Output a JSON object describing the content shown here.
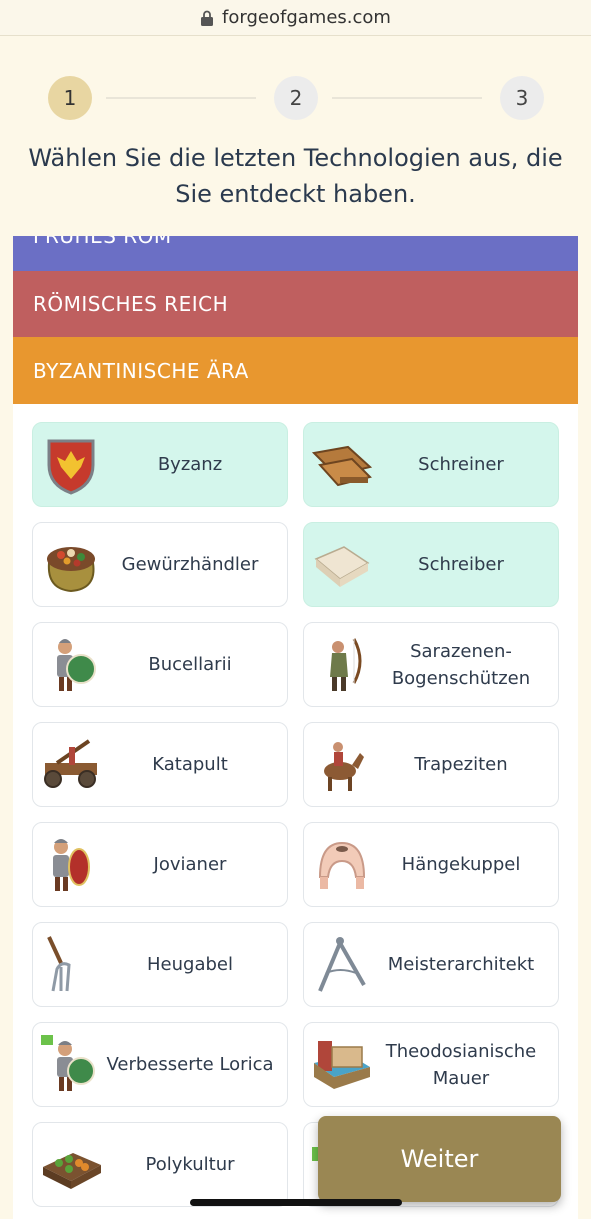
{
  "browser": {
    "url": "forgeofgames.com"
  },
  "stepper": {
    "steps": [
      "1",
      "2",
      "3"
    ],
    "active": 1
  },
  "question": "Wählen Sie die letzten Technologien aus, die Sie entdeckt haben.",
  "eras": [
    {
      "label": "FRÜHES ROM",
      "color": "#6b6fc5"
    },
    {
      "label": "RÖMISCHES REICH",
      "color": "#bf5f5f"
    },
    {
      "label": "BYZANTINISCHE ÄRA",
      "color": "#e8972f"
    }
  ],
  "technologies": [
    {
      "label": "Byzanz",
      "icon": "shield-eagle-icon",
      "selected": true
    },
    {
      "label": "Schreiner",
      "icon": "wood-planks-icon",
      "selected": true
    },
    {
      "label": "Gewürzhändler",
      "icon": "spice-sack-icon",
      "selected": false
    },
    {
      "label": "Schreiber",
      "icon": "paper-stack-icon",
      "selected": true
    },
    {
      "label": "Bucellarii",
      "icon": "soldier-shield-icon",
      "selected": false
    },
    {
      "label": "Sarazenen-Bogenschützen",
      "icon": "archer-icon",
      "selected": false
    },
    {
      "label": "Katapult",
      "icon": "catapult-icon",
      "selected": false
    },
    {
      "label": "Trapeziten",
      "icon": "horseman-icon",
      "selected": false
    },
    {
      "label": "Jovianer",
      "icon": "soldier-red-shield-icon",
      "selected": false
    },
    {
      "label": "Hängekuppel",
      "icon": "dome-icon",
      "selected": false
    },
    {
      "label": "Heugabel",
      "icon": "pitchfork-icon",
      "selected": false
    },
    {
      "label": "Meisterarchitekt",
      "icon": "compass-icon",
      "selected": false
    },
    {
      "label": "Verbesserte Lorica",
      "icon": "soldier-upgrade-icon",
      "selected": false
    },
    {
      "label": "Theodosianische Mauer",
      "icon": "wall-icon",
      "selected": false
    },
    {
      "label": "Polykultur",
      "icon": "crop-field-icon",
      "selected": false
    },
    {
      "label": "",
      "icon": "upgrade-badge-icon",
      "selected": false
    }
  ],
  "buttons": {
    "next": "Weiter"
  }
}
